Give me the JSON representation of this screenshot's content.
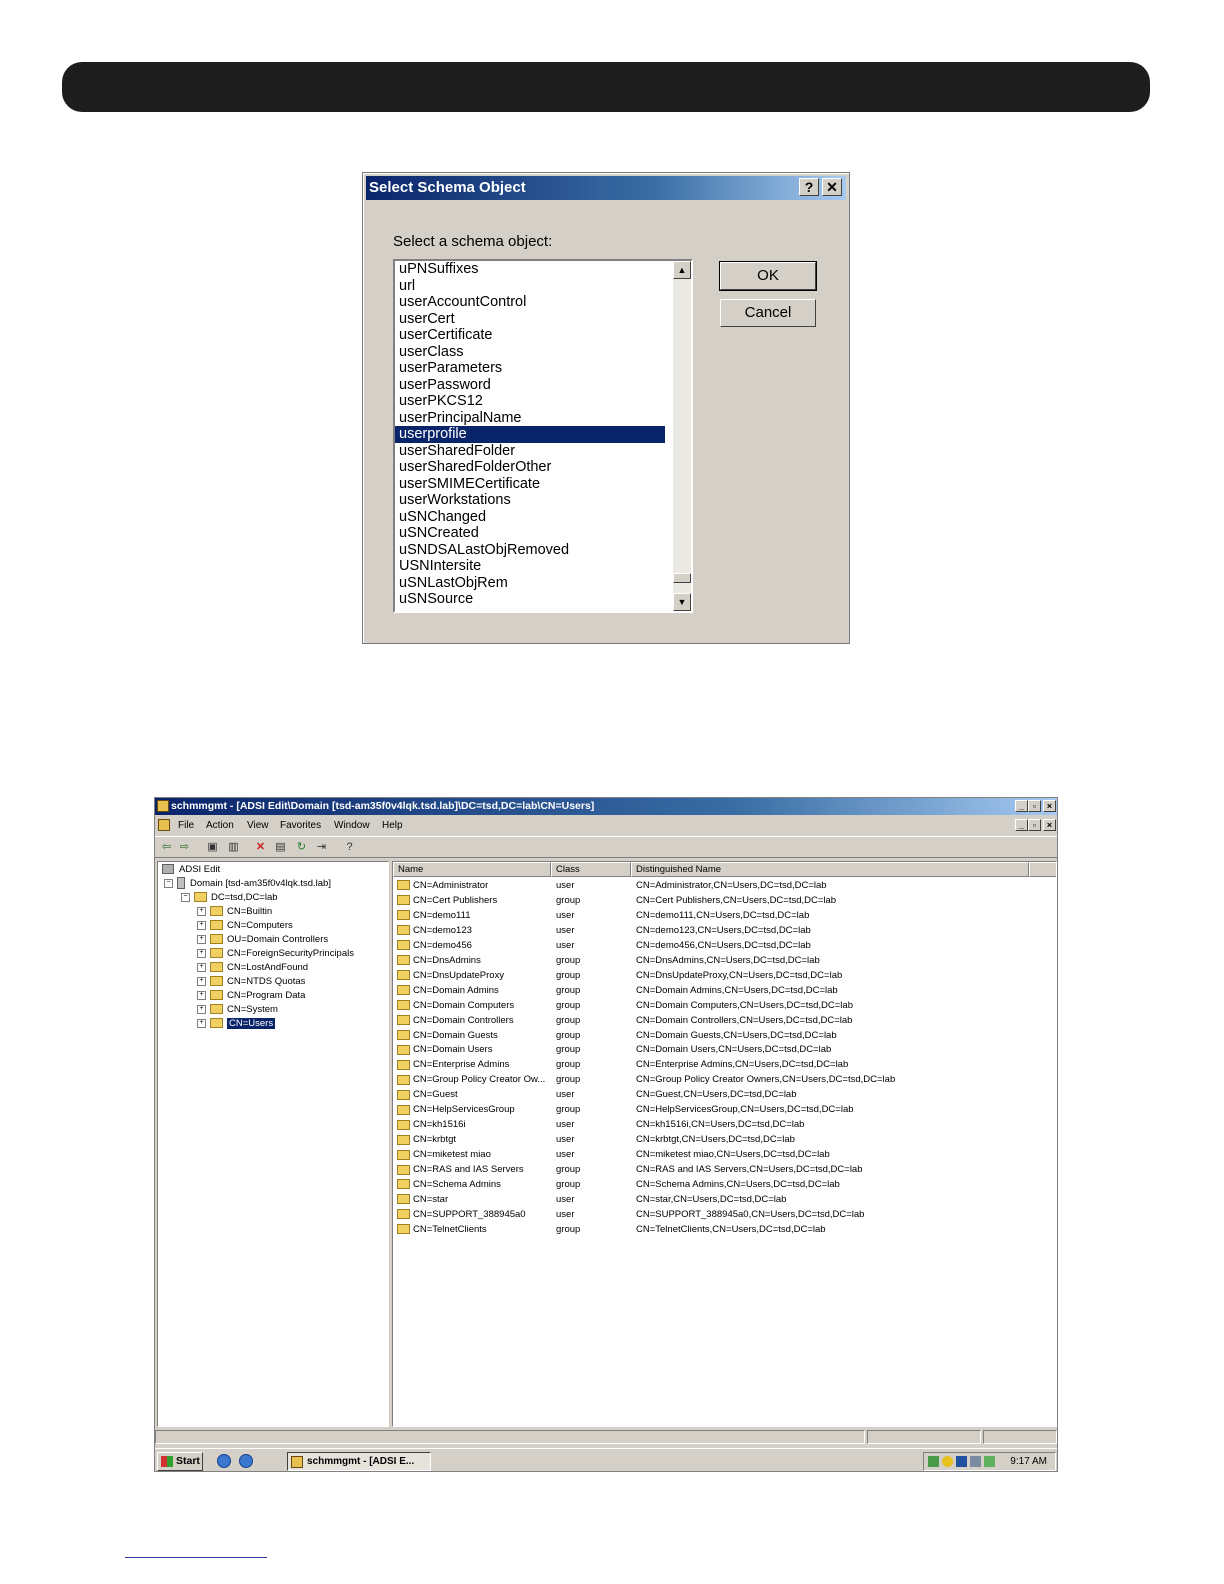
{
  "dialog": {
    "title": "Select Schema Object",
    "help_button": "?",
    "close_button": "✕",
    "prompt": "Select a schema object:",
    "items": [
      "uPNSuffixes",
      "url",
      "userAccountControl",
      "userCert",
      "userCertificate",
      "userClass",
      "userParameters",
      "userPassword",
      "userPKCS12",
      "userPrincipalName",
      "userprofile",
      "userSharedFolder",
      "userSharedFolderOther",
      "userSMIMECertificate",
      "userWorkstations",
      "uSNChanged",
      "uSNCreated",
      "uSNDSALastObjRemoved",
      "USNIntersite",
      "uSNLastObjRem",
      "uSNSource"
    ],
    "selected_item": "userprofile",
    "ok_label": "OK",
    "cancel_label": "Cancel"
  },
  "window": {
    "title": "schmmgmt - [ADSI Edit\\Domain [tsd-am35f0v4lqk.tsd.lab]\\DC=tsd,DC=lab\\CN=Users]",
    "menu": [
      "File",
      "Action",
      "View",
      "Favorites",
      "Window",
      "Help"
    ],
    "tree": {
      "root": "ADSI Edit",
      "domain": "Domain [tsd-am35f0v4lqk.tsd.lab]",
      "dc": "DC=tsd,DC=lab",
      "children": [
        "CN=Builtin",
        "CN=Computers",
        "OU=Domain Controllers",
        "CN=ForeignSecurityPrincipals",
        "CN=LostAndFound",
        "CN=NTDS Quotas",
        "CN=Program Data",
        "CN=System",
        "CN=Users"
      ],
      "selected": "CN=Users"
    },
    "columns": [
      "Name",
      "Class",
      "Distinguished Name"
    ],
    "rows": [
      [
        "CN=Administrator",
        "user",
        "CN=Administrator,CN=Users,DC=tsd,DC=lab"
      ],
      [
        "CN=Cert Publishers",
        "group",
        "CN=Cert Publishers,CN=Users,DC=tsd,DC=lab"
      ],
      [
        "CN=demo111",
        "user",
        "CN=demo111,CN=Users,DC=tsd,DC=lab"
      ],
      [
        "CN=demo123",
        "user",
        "CN=demo123,CN=Users,DC=tsd,DC=lab"
      ],
      [
        "CN=demo456",
        "user",
        "CN=demo456,CN=Users,DC=tsd,DC=lab"
      ],
      [
        "CN=DnsAdmins",
        "group",
        "CN=DnsAdmins,CN=Users,DC=tsd,DC=lab"
      ],
      [
        "CN=DnsUpdateProxy",
        "group",
        "CN=DnsUpdateProxy,CN=Users,DC=tsd,DC=lab"
      ],
      [
        "CN=Domain Admins",
        "group",
        "CN=Domain Admins,CN=Users,DC=tsd,DC=lab"
      ],
      [
        "CN=Domain Computers",
        "group",
        "CN=Domain Computers,CN=Users,DC=tsd,DC=lab"
      ],
      [
        "CN=Domain Controllers",
        "group",
        "CN=Domain Controllers,CN=Users,DC=tsd,DC=lab"
      ],
      [
        "CN=Domain Guests",
        "group",
        "CN=Domain Guests,CN=Users,DC=tsd,DC=lab"
      ],
      [
        "CN=Domain Users",
        "group",
        "CN=Domain Users,CN=Users,DC=tsd,DC=lab"
      ],
      [
        "CN=Enterprise Admins",
        "group",
        "CN=Enterprise Admins,CN=Users,DC=tsd,DC=lab"
      ],
      [
        "CN=Group Policy Creator Ow...",
        "group",
        "CN=Group Policy Creator Owners,CN=Users,DC=tsd,DC=lab"
      ],
      [
        "CN=Guest",
        "user",
        "CN=Guest,CN=Users,DC=tsd,DC=lab"
      ],
      [
        "CN=HelpServicesGroup",
        "group",
        "CN=HelpServicesGroup,CN=Users,DC=tsd,DC=lab"
      ],
      [
        "CN=kh1516i",
        "user",
        "CN=kh1516i,CN=Users,DC=tsd,DC=lab"
      ],
      [
        "CN=krbtgt",
        "user",
        "CN=krbtgt,CN=Users,DC=tsd,DC=lab"
      ],
      [
        "CN=miketest miao",
        "user",
        "CN=miketest miao,CN=Users,DC=tsd,DC=lab"
      ],
      [
        "CN=RAS and IAS Servers",
        "group",
        "CN=RAS and IAS Servers,CN=Users,DC=tsd,DC=lab"
      ],
      [
        "CN=Schema Admins",
        "group",
        "CN=Schema Admins,CN=Users,DC=tsd,DC=lab"
      ],
      [
        "CN=star",
        "user",
        "CN=star,CN=Users,DC=tsd,DC=lab"
      ],
      [
        "CN=SUPPORT_388945a0",
        "user",
        "CN=SUPPORT_388945a0,CN=Users,DC=tsd,DC=lab"
      ],
      [
        "CN=TelnetClients",
        "group",
        "CN=TelnetClients,CN=Users,DC=tsd,DC=lab"
      ]
    ]
  },
  "taskbar": {
    "start_label": "Start",
    "task_label": "schmmgmt - [ADSI E...",
    "clock": "9:17 AM"
  },
  "colors": {
    "selection": "#0a246a",
    "title_gradient_start": "#0a246a",
    "title_gradient_end": "#a6caf0",
    "face": "#d4d0c8",
    "banner": "#1d1d1d"
  }
}
